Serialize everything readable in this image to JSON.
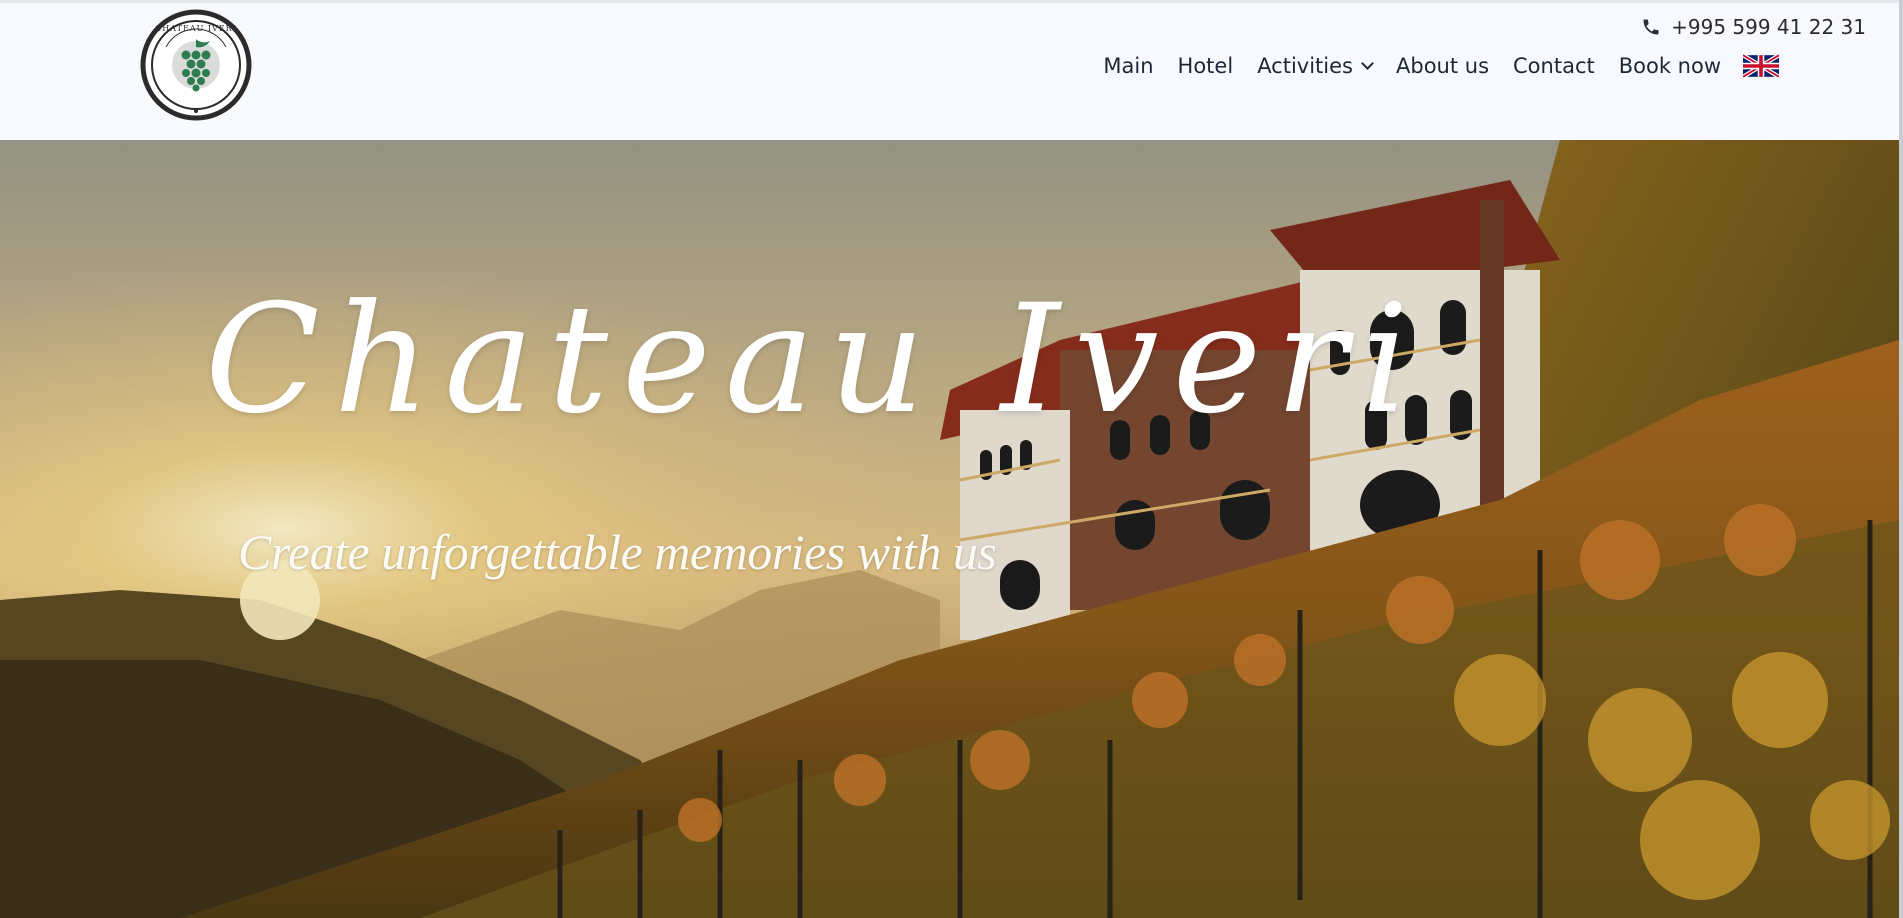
{
  "header": {
    "logo_text": "CHATEAU IVERI",
    "phone": "+995 599 41 22 31",
    "nav": [
      {
        "label": "Main"
      },
      {
        "label": "Hotel"
      },
      {
        "label": "Activities"
      },
      {
        "label": "About us"
      },
      {
        "label": "Contact"
      },
      {
        "label": "Book now"
      }
    ],
    "language_icon": "uk-flag-icon"
  },
  "hero": {
    "title": "Chateau Iveri",
    "subtitle": "Create unforgettable memories with us"
  },
  "colors": {
    "header_bg": "#f8f9fe",
    "nav_text": "#1d2733",
    "logo_green": "#2e7d4f",
    "hero_text": "#ffffff"
  }
}
